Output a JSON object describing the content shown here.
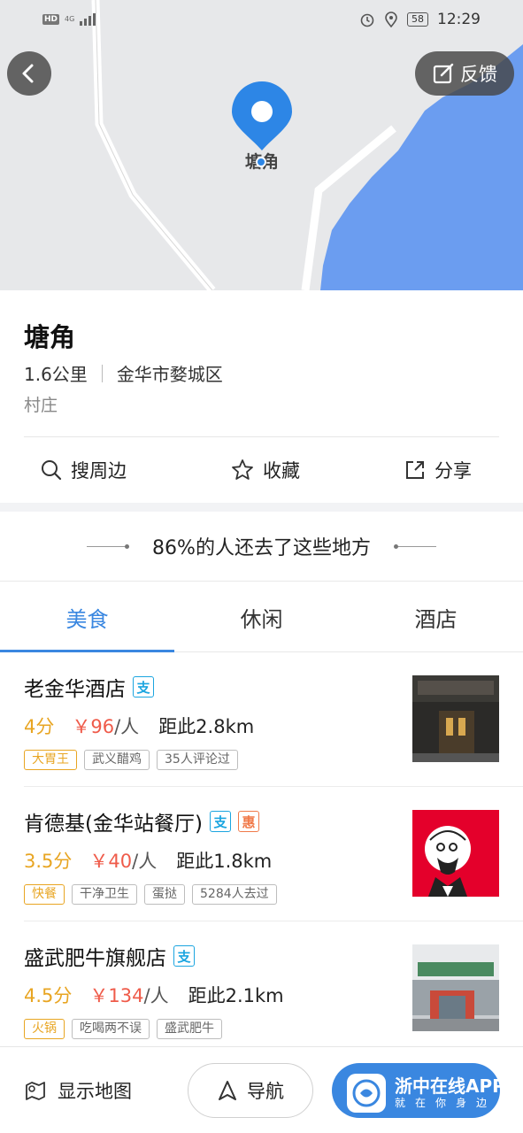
{
  "status_bar": {
    "hd": "HD",
    "network": "4G",
    "battery": "58",
    "time": "12:29"
  },
  "map": {
    "back_icon": "chevron-left-icon",
    "feedback_label": "反馈",
    "pin_label": "塘角",
    "water_color": "#6b9df0",
    "pin_color": "#2d86e6"
  },
  "place": {
    "name": "塘角",
    "distance": "1.6公里",
    "district": "金华市婺城区",
    "type": "村庄"
  },
  "actions": {
    "search_nearby": "搜周边",
    "favorite": "收藏",
    "share": "分享"
  },
  "recommend": {
    "heading": "86%的人还去了这些地方",
    "tabs": [
      "美食",
      "休闲",
      "酒店"
    ],
    "active_tab": 0,
    "items": [
      {
        "name": "老金华酒店",
        "badges": [
          "支"
        ],
        "score": "4分",
        "price": "￥96",
        "per": "/人",
        "distance": "距此2.8km",
        "chips": [
          "大胃王",
          "武义醋鸡",
          "35人评论过"
        ]
      },
      {
        "name": "肯德基(金华站餐厅)",
        "badges": [
          "支",
          "惠"
        ],
        "score": "3.5分",
        "price": "￥40",
        "per": "/人",
        "distance": "距此1.8km",
        "chips": [
          "快餐",
          "干净卫生",
          "蛋挞",
          "5284人去过"
        ]
      },
      {
        "name": "盛武肥牛旗舰店",
        "badges": [
          "支"
        ],
        "score": "4.5分",
        "price": "￥134",
        "per": "/人",
        "distance": "距此2.1km",
        "chips": [
          "火锅",
          "吃喝两不误",
          "盛武肥牛"
        ]
      }
    ]
  },
  "bottom_bar": {
    "show_map": "显示地图",
    "navigate": "导航",
    "accent": "#3a87e0"
  },
  "watermark": {
    "title": "浙中在线APP",
    "subtitle": "就在你身边"
  }
}
